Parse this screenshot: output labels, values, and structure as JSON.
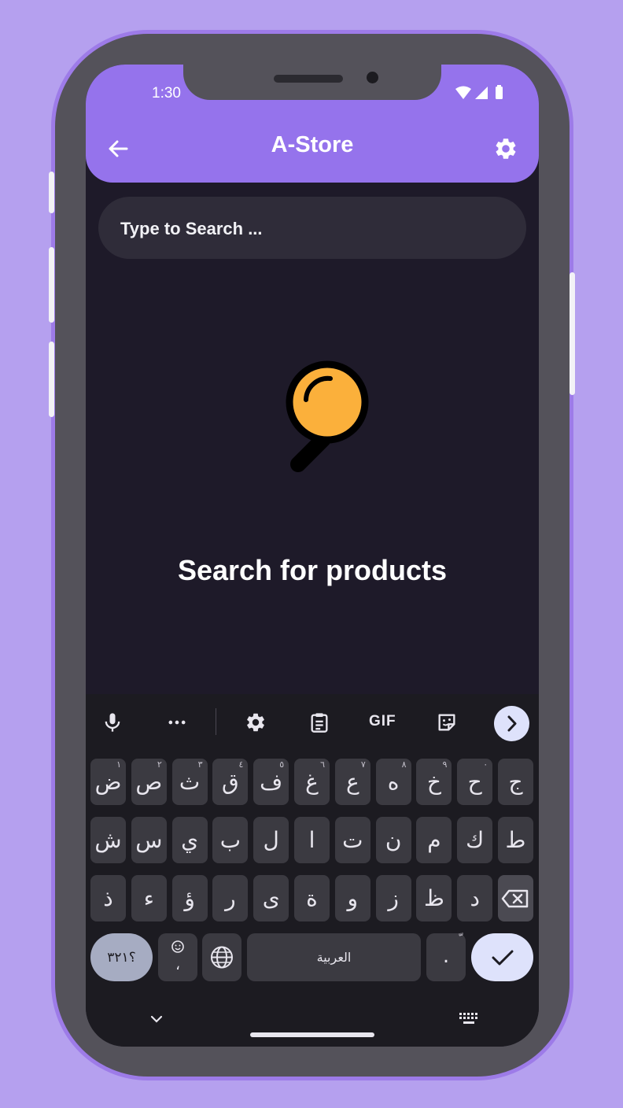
{
  "status_bar": {
    "time": "1:30"
  },
  "app_bar": {
    "title": "A-Store"
  },
  "search": {
    "placeholder": "Type to Search ..."
  },
  "empty_state": {
    "message": "Search for products",
    "icon": "magnifier-icon"
  },
  "colors": {
    "accent": "#9573ec",
    "background": "#1e1a29",
    "search_field": "#2f2c39",
    "magnifier_lens": "#fbb03b"
  },
  "keyboard": {
    "toolbar": {
      "gif_label": "GIF"
    },
    "rows": [
      [
        {
          "char": "ض",
          "hint": "١"
        },
        {
          "char": "ص",
          "hint": "٢"
        },
        {
          "char": "ث",
          "hint": "٣"
        },
        {
          "char": "ق",
          "hint": "٤"
        },
        {
          "char": "ف",
          "hint": "٥"
        },
        {
          "char": "غ",
          "hint": "٦"
        },
        {
          "char": "ع",
          "hint": "٧"
        },
        {
          "char": "ه",
          "hint": "٨"
        },
        {
          "char": "خ",
          "hint": "٩"
        },
        {
          "char": "ح",
          "hint": "٠"
        },
        {
          "char": "ج",
          "hint": ""
        }
      ],
      [
        {
          "char": "ش",
          "hint": ""
        },
        {
          "char": "س",
          "hint": ""
        },
        {
          "char": "ي",
          "hint": ""
        },
        {
          "char": "ب",
          "hint": ""
        },
        {
          "char": "ل",
          "hint": ""
        },
        {
          "char": "ا",
          "hint": ""
        },
        {
          "char": "ت",
          "hint": ""
        },
        {
          "char": "ن",
          "hint": ""
        },
        {
          "char": "م",
          "hint": ""
        },
        {
          "char": "ك",
          "hint": ""
        },
        {
          "char": "ط",
          "hint": ""
        }
      ],
      [
        {
          "char": "ذ",
          "hint": ""
        },
        {
          "char": "ء",
          "hint": ""
        },
        {
          "char": "ؤ",
          "hint": ""
        },
        {
          "char": "ر",
          "hint": ""
        },
        {
          "char": "ى",
          "hint": ""
        },
        {
          "char": "ة",
          "hint": ""
        },
        {
          "char": "و",
          "hint": ""
        },
        {
          "char": "ز",
          "hint": ""
        },
        {
          "char": "ظ",
          "hint": ""
        },
        {
          "char": "د",
          "hint": ""
        }
      ]
    ],
    "symbols_label": "؟٣٢١",
    "emoji_comma": "،",
    "space_label": "العربية",
    "period_label": ".",
    "period_hint": "ّ"
  }
}
